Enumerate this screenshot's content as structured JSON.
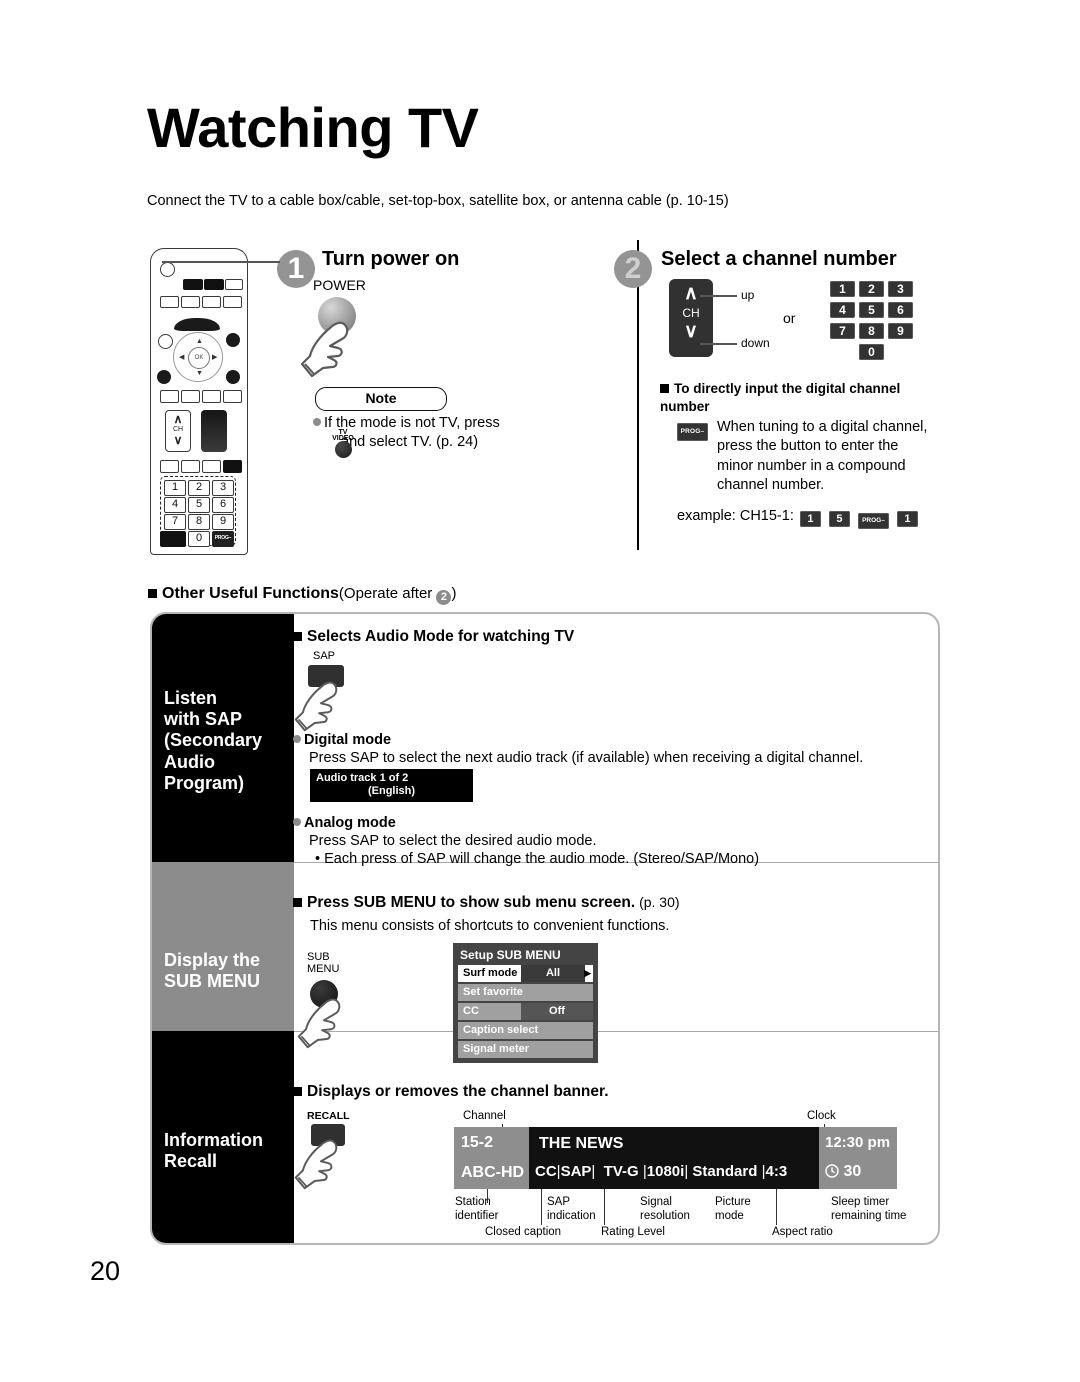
{
  "page": {
    "title": "Watching TV",
    "intro": "Connect the TV to a cable box/cable, set-top-box, satellite box, or antenna cable (p. 10-15)",
    "number": "20"
  },
  "steps": [
    {
      "num": "1",
      "title": "Turn power on"
    },
    {
      "num": "2",
      "title": "Select a channel number"
    }
  ],
  "step1": {
    "power_label": "POWER",
    "note_title": "Note",
    "note_text_a": "If the mode is not TV, press",
    "note_text_b": "and select TV. (p. 24)",
    "tv_video_line1": "TV",
    "tv_video_line2": "VIDEO"
  },
  "step2": {
    "ch_up_arrow": "∧",
    "ch_label": "CH",
    "ch_down_arrow": "∨",
    "up_label": "up",
    "down_label": "down",
    "or_label": "or",
    "numpad": [
      "1",
      "2",
      "3",
      "4",
      "5",
      "6",
      "7",
      "8",
      "9",
      "0"
    ],
    "subhead": "To directly input the digital channel number",
    "prog_key": "PROG–",
    "prog_text": "When tuning to a digital channel, press the button to enter the minor number in a compound channel number.",
    "example_label": "example:  CH15-1:",
    "example_keys": [
      "1",
      "5",
      "PROG–",
      "1"
    ]
  },
  "other_functions": {
    "head_bold": "Other Useful Functions",
    "head_normal_pre": "(Operate after ",
    "head_circle": "2",
    "head_normal_post": ")"
  },
  "sections": [
    {
      "band_label": "Listen\nwith SAP\n(Secondary\nAudio\nProgram)",
      "heading": "Selects Audio Mode for watching TV",
      "heading_page": "",
      "button_label": "SAP",
      "digital_head": "Digital mode",
      "digital_text": "Press SAP to select the next audio track (if available) when receiving a digital channel.",
      "osd_line1": "Audio track 1 of 2",
      "osd_line2": "(English)",
      "analog_head": "Analog mode",
      "analog_text": "Press SAP to select the desired audio mode.",
      "analog_bullet": "• Each press of SAP will change the audio mode. (Stereo/SAP/Mono)"
    },
    {
      "band_label": "Display the\nSUB MENU",
      "heading": "Press SUB MENU to show sub menu screen.",
      "heading_page": "(p. 30)",
      "button_label_line1": "SUB",
      "button_label_line2": "MENU",
      "body": "This menu consists of shortcuts to convenient functions.",
      "osd_title": "Setup SUB MENU",
      "osd_rows": [
        {
          "label": "Surf mode",
          "value": "All",
          "selected": true
        },
        {
          "label": "Set favorite",
          "value": "",
          "selected": false
        },
        {
          "label": "CC",
          "value": "Off",
          "selected": false
        },
        {
          "label": "Caption select",
          "value": "",
          "selected": false
        },
        {
          "label": "Signal meter",
          "value": "",
          "selected": false
        }
      ]
    },
    {
      "band_label": "Information\nRecall",
      "heading": "Displays or removes the channel banner.",
      "heading_page": "",
      "button_label": "RECALL",
      "banner": {
        "channel": "15-2",
        "station": "ABC-HD",
        "program": "THE NEWS",
        "cc": "CC",
        "sap": "SAP",
        "rating": "TV-G",
        "resolution": "1080i",
        "picture_mode": "Standard",
        "aspect": "4:3",
        "clock": "12:30 pm",
        "sleep_timer": "30"
      },
      "callouts": {
        "channel": "Channel",
        "clock": "Clock",
        "station_identifier": "Station\nidentifier",
        "sap_indication": "SAP\nindication",
        "signal_resolution": "Signal\nresolution",
        "picture_mode": "Picture\nmode",
        "sleep_timer": "Sleep timer\nremaining time",
        "closed_caption": "Closed caption",
        "rating_level": "Rating Level",
        "aspect_ratio": "Aspect ratio"
      }
    }
  ],
  "colors": {
    "band_black": "#000000",
    "band_gray": "#8c8c8c",
    "step_circle": "#949494",
    "osd_background": "#444444",
    "banner_gray": "#8e8e8e",
    "banner_black": "#111111"
  }
}
